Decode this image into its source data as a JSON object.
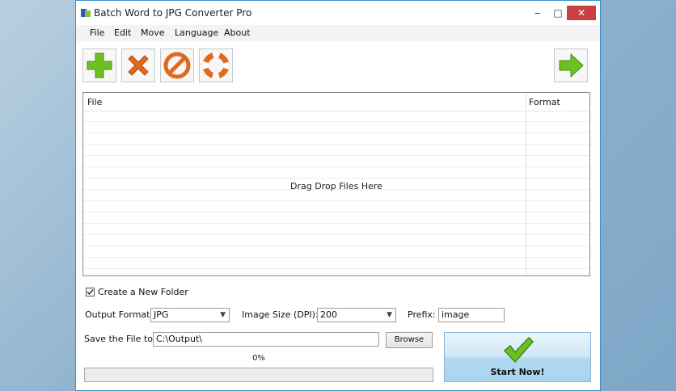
{
  "window": {
    "title": "Batch Word to JPG Converter Pro",
    "controls": {
      "minimize": "‒",
      "maximize": "□",
      "close": "✕"
    }
  },
  "menu": [
    "File",
    "Edit",
    "Move",
    "Language",
    "About"
  ],
  "toolbar": {
    "buttons": [
      {
        "icon": "add-icon",
        "color": "#6cc024"
      },
      {
        "icon": "remove-icon",
        "color": "#e06a1c"
      },
      {
        "icon": "clear-icon",
        "color": "#e06a1c"
      },
      {
        "icon": "help-lifebuoy-icon",
        "color": "#e06a1c"
      },
      {
        "icon": "next-arrow-icon",
        "color": "#6cc024"
      }
    ]
  },
  "file_list": {
    "columns": [
      "File",
      "Format"
    ],
    "empty_hint": "Drag  Drop Files Here",
    "rows": []
  },
  "options": {
    "create_folder_label": "Create a New Folder",
    "create_folder_checked": true,
    "output_format_label": "Output Format:",
    "output_format_value": "JPG",
    "image_size_label": "Image Size (DPI):",
    "image_size_value": "200",
    "prefix_label": "Prefix:",
    "prefix_value": "image",
    "save_label": "Save the File to",
    "save_path": "C:\\Output\\",
    "browse_label": "Browse"
  },
  "progress": {
    "text": "0%",
    "value": 0
  },
  "start_button": {
    "label": "Start Now!"
  }
}
